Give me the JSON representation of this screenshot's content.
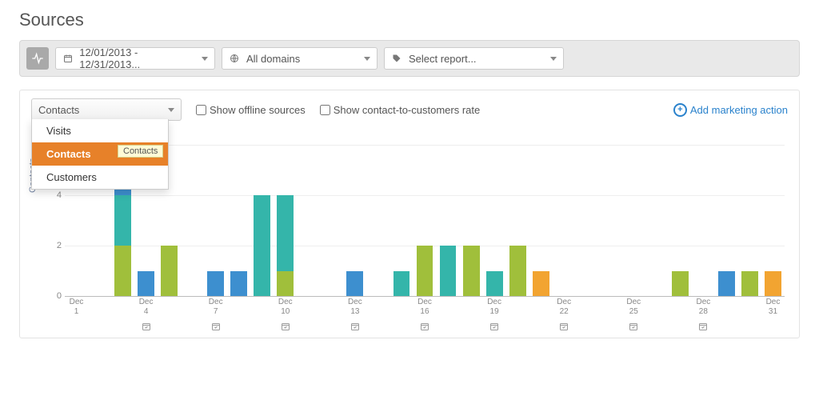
{
  "page_title": "Sources",
  "toolbar": {
    "date_range": "12/01/2013 - 12/31/2013...",
    "domain": "All domains",
    "report": "Select report..."
  },
  "panel": {
    "metric_selected": "Contacts",
    "metric_options": [
      "Visits",
      "Contacts",
      "Customers"
    ],
    "tooltip": "Contacts",
    "show_offline_label": "Show offline sources",
    "show_c2c_label": "Show contact-to-customers rate",
    "add_label": "Add marketing action"
  },
  "chart_data": {
    "type": "bar",
    "stacked": true,
    "ylabel": "Contacts",
    "ylim": [
      0,
      6
    ],
    "yticks": [
      0,
      2,
      4,
      6
    ],
    "x_tick_labels": [
      {
        "day": 1,
        "top": "Dec",
        "bot": "1"
      },
      {
        "day": 4,
        "top": "Dec",
        "bot": "4"
      },
      {
        "day": 7,
        "top": "Dec",
        "bot": "7"
      },
      {
        "day": 10,
        "top": "Dec",
        "bot": "10"
      },
      {
        "day": 13,
        "top": "Dec",
        "bot": "13"
      },
      {
        "day": 16,
        "top": "Dec",
        "bot": "16"
      },
      {
        "day": 19,
        "top": "Dec",
        "bot": "19"
      },
      {
        "day": 22,
        "top": "Dec",
        "bot": "22"
      },
      {
        "day": 25,
        "top": "Dec",
        "bot": "25"
      },
      {
        "day": 28,
        "top": "Dec",
        "bot": "28"
      },
      {
        "day": 31,
        "top": "Dec",
        "bot": "31"
      }
    ],
    "calendar_marks": [
      4,
      7,
      10,
      13,
      16,
      19,
      22,
      25,
      28
    ],
    "series_colors": {
      "blue": "#3d8fcf",
      "teal": "#34b5aa",
      "green": "#a0bf3b",
      "amber": "#f2a431"
    },
    "days": [
      {
        "day": 1,
        "stacks": []
      },
      {
        "day": 2,
        "stacks": []
      },
      {
        "day": 3,
        "stacks": [
          {
            "c": "blue",
            "v": 2
          },
          {
            "c": "teal",
            "v": 2
          },
          {
            "c": "green",
            "v": 2
          }
        ]
      },
      {
        "day": 4,
        "stacks": [
          {
            "c": "blue",
            "v": 1
          }
        ]
      },
      {
        "day": 5,
        "stacks": [
          {
            "c": "green",
            "v": 2
          }
        ]
      },
      {
        "day": 6,
        "stacks": []
      },
      {
        "day": 7,
        "stacks": [
          {
            "c": "blue",
            "v": 1
          }
        ]
      },
      {
        "day": 8,
        "stacks": [
          {
            "c": "blue",
            "v": 1
          }
        ]
      },
      {
        "day": 9,
        "stacks": [
          {
            "c": "teal",
            "v": 4
          }
        ]
      },
      {
        "day": 10,
        "stacks": [
          {
            "c": "teal",
            "v": 3
          },
          {
            "c": "green",
            "v": 1
          }
        ]
      },
      {
        "day": 11,
        "stacks": []
      },
      {
        "day": 12,
        "stacks": []
      },
      {
        "day": 13,
        "stacks": [
          {
            "c": "blue",
            "v": 1
          }
        ]
      },
      {
        "day": 14,
        "stacks": []
      },
      {
        "day": 15,
        "stacks": [
          {
            "c": "teal",
            "v": 1
          }
        ]
      },
      {
        "day": 16,
        "stacks": [
          {
            "c": "green",
            "v": 2
          }
        ]
      },
      {
        "day": 17,
        "stacks": [
          {
            "c": "teal",
            "v": 2
          }
        ]
      },
      {
        "day": 18,
        "stacks": [
          {
            "c": "green",
            "v": 2
          }
        ]
      },
      {
        "day": 19,
        "stacks": [
          {
            "c": "teal",
            "v": 1
          }
        ]
      },
      {
        "day": 20,
        "stacks": [
          {
            "c": "green",
            "v": 2
          }
        ]
      },
      {
        "day": 21,
        "stacks": [
          {
            "c": "amber",
            "v": 1
          }
        ]
      },
      {
        "day": 22,
        "stacks": []
      },
      {
        "day": 23,
        "stacks": []
      },
      {
        "day": 24,
        "stacks": []
      },
      {
        "day": 25,
        "stacks": []
      },
      {
        "day": 26,
        "stacks": []
      },
      {
        "day": 27,
        "stacks": [
          {
            "c": "green",
            "v": 1
          }
        ]
      },
      {
        "day": 28,
        "stacks": []
      },
      {
        "day": 29,
        "stacks": [
          {
            "c": "blue",
            "v": 1
          }
        ]
      },
      {
        "day": 30,
        "stacks": [
          {
            "c": "green",
            "v": 1
          }
        ]
      },
      {
        "day": 31,
        "stacks": [
          {
            "c": "amber",
            "v": 1
          }
        ]
      }
    ]
  }
}
